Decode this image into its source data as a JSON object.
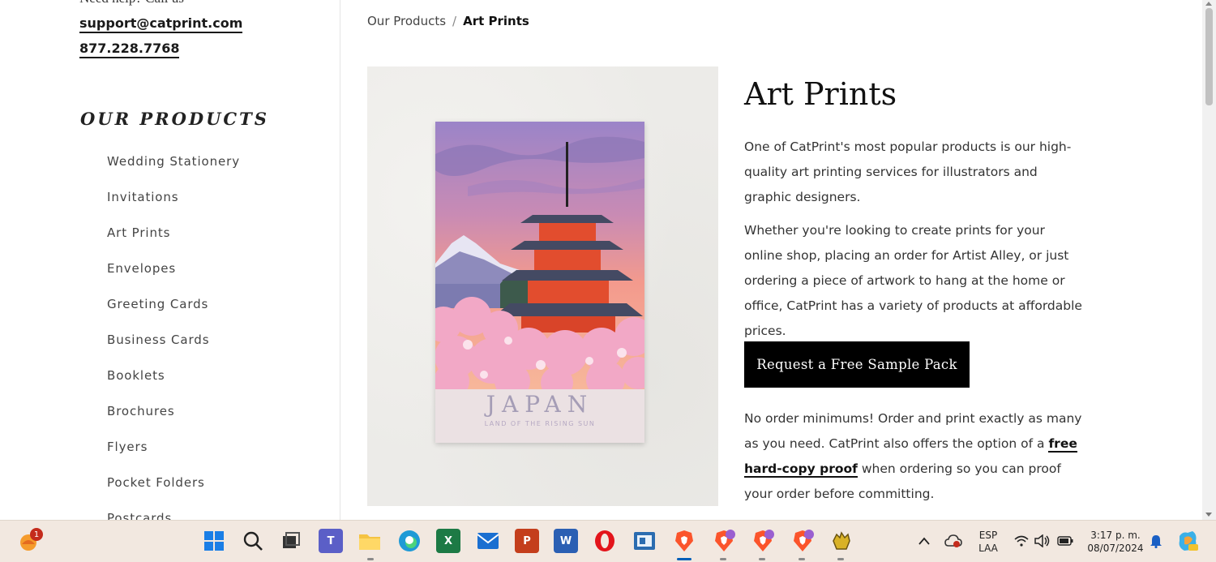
{
  "sidebar": {
    "contact_top_cut": "Need help? Call us",
    "email": "support@catprint.com",
    "phone": "877.228.7768",
    "products_heading": "OUR PRODUCTS",
    "items": [
      {
        "label": "Wedding Stationery"
      },
      {
        "label": "Invitations"
      },
      {
        "label": "Art Prints"
      },
      {
        "label": "Envelopes"
      },
      {
        "label": "Greeting Cards"
      },
      {
        "label": "Business Cards"
      },
      {
        "label": "Booklets"
      },
      {
        "label": "Brochures"
      },
      {
        "label": "Flyers"
      },
      {
        "label": "Pocket Folders"
      },
      {
        "label": "Postcards"
      }
    ]
  },
  "breadcrumb": {
    "parent": "Our Products",
    "separator": "/",
    "current": "Art Prints"
  },
  "product": {
    "image_card_title": "JAPAN",
    "image_card_subtitle": "LAND OF THE RISING SUN",
    "title": "Art Prints",
    "paragraph1": "One of CatPrint's most popular products is our high-quality art printing services for illustrators and graphic designers.",
    "paragraph2": "Whether you're looking to create prints for your online shop, placing an order for Artist Alley, or just ordering a piece of artwork to hang at the home or office, CatPrint has a variety of products at affordable prices.",
    "cta_label": "Request a Free Sample Pack",
    "paragraph3_before": "No order minimums! Order and print exactly as many as you need. CatPrint also offers the option of a ",
    "paragraph3_link": "free hard-copy proof",
    "paragraph3_after": " when ordering so you can proof your order before committing."
  },
  "taskbar": {
    "weather_badge_count": "1",
    "language_line1": "ESP",
    "language_line2": "LAA",
    "time": "3:17 p. m.",
    "date": "08/07/2024",
    "icons": [
      "weather-icon",
      "windows-start-icon",
      "search-icon",
      "task-view-icon",
      "teams-icon",
      "file-explorer-icon",
      "edge-icon",
      "excel-icon",
      "mail-icon",
      "powerpoint-icon",
      "word-icon",
      "opera-icon",
      "app-window-icon",
      "brave-icon",
      "brave-icon",
      "brave-icon",
      "brave-icon",
      "yellow-glove-icon",
      "chevron-up-icon",
      "cloud-sync-icon",
      "wifi-icon",
      "volume-icon",
      "battery-icon",
      "notification-bell-icon",
      "copilot-icon"
    ]
  },
  "colors": {
    "accent_black": "#000000",
    "taskbar_bg": "#f2e8e0",
    "active_indicator": "#005fb8"
  }
}
